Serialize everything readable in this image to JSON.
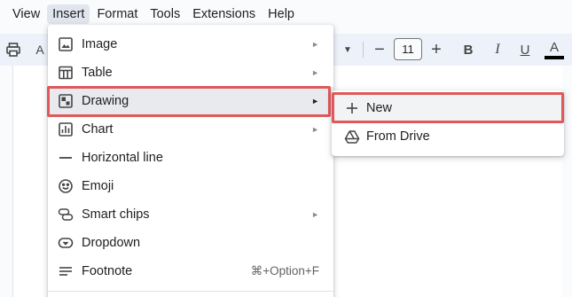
{
  "menubar": {
    "items": [
      "View",
      "Insert",
      "Format",
      "Tools",
      "Extensions",
      "Help"
    ],
    "active": "Insert"
  },
  "toolbar": {
    "font_size": "11",
    "bold": "B",
    "italic": "I",
    "underline": "U",
    "text_color": "A",
    "text_color_value": "#000000",
    "minus": "−",
    "plus": "+",
    "spell": "A"
  },
  "insert_menu": {
    "items": [
      {
        "label": "Image",
        "icon": "image-icon",
        "submenu": true
      },
      {
        "label": "Table",
        "icon": "table-icon",
        "submenu": true
      },
      {
        "label": "Drawing",
        "icon": "drawing-icon",
        "submenu": true,
        "highlighted": true
      },
      {
        "label": "Chart",
        "icon": "chart-icon",
        "submenu": true
      },
      {
        "label": "Horizontal line",
        "icon": "horizontal-line-icon"
      },
      {
        "label": "Emoji",
        "icon": "emoji-icon"
      },
      {
        "label": "Smart chips",
        "icon": "smart-chips-icon",
        "submenu": true
      },
      {
        "label": "Dropdown",
        "icon": "dropdown-icon"
      },
      {
        "label": "Footnote",
        "icon": "footnote-icon",
        "shortcut": "⌘+Option+F"
      }
    ],
    "submenu_arrow": "►"
  },
  "drawing_submenu": {
    "items": [
      {
        "label": "New",
        "icon": "plus-icon",
        "highlighted": true
      },
      {
        "label": "From Drive",
        "icon": "drive-icon"
      }
    ]
  },
  "colors": {
    "highlight_border": "#e0585a",
    "hover": "#e8eaed",
    "toolbar_bg": "#edf2fa"
  }
}
